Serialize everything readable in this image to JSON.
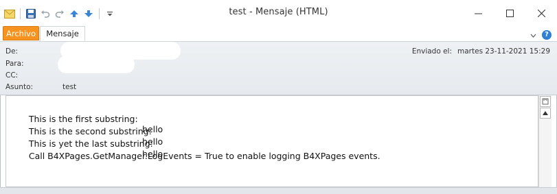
{
  "window": {
    "title": "test  -  Mensaje (HTML)"
  },
  "tabs": {
    "file_label": "Archivo",
    "message_label": "Mensaje"
  },
  "header": {
    "from_label": "De:",
    "to_label": "Para:",
    "cc_label": "CC:",
    "subject_label": "Asunto:",
    "subject_value": "test",
    "sent_label": "Enviado el:",
    "sent_value": "martes 23-11-2021 15:29"
  },
  "body": {
    "lines": [
      {
        "text": "This is the first substring:",
        "value": "hello"
      },
      {
        "text": "This is the second substring:",
        "value": "hello"
      },
      {
        "text": "This is yet the last substring:",
        "value": "hello"
      },
      {
        "text": "Call B4XPages.GetManager.LogEvents = True to enable logging B4XPages events.",
        "value": ""
      }
    ]
  },
  "colors": {
    "file_tab": "#f7931e",
    "accent_blue": "#2f7fd3"
  },
  "icons": [
    "mail-icon",
    "save-icon",
    "undo-icon",
    "redo-icon",
    "previous-icon",
    "next-icon",
    "customize-quick-access-icon",
    "minimize-icon",
    "maximize-icon",
    "close-icon",
    "ribbon-expand-icon",
    "help-icon"
  ]
}
